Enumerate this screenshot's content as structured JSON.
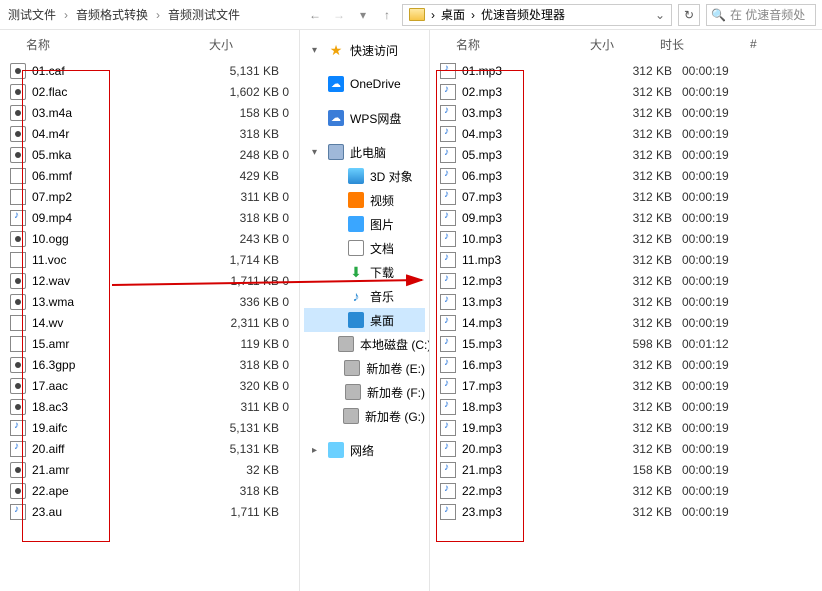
{
  "left_crumb": [
    "测试文件",
    "音频格式转换",
    "音频测试文件"
  ],
  "right_addr": {
    "parts": [
      "桌面",
      "优速音频处理器"
    ],
    "search_placeholder": "在 优速音频处"
  },
  "cols_left": {
    "name": "名称",
    "size": "大小"
  },
  "cols_right": {
    "name": "名称",
    "size": "大小",
    "duration": "时长",
    "num": "#"
  },
  "left_files": [
    {
      "ico": "audio",
      "name": "01.caf",
      "size": "5,131 KB"
    },
    {
      "ico": "audio",
      "name": "02.flac",
      "size": "1,602 KB",
      "extra": "0"
    },
    {
      "ico": "audio",
      "name": "03.m4a",
      "size": "158 KB",
      "extra": "0"
    },
    {
      "ico": "audio",
      "name": "04.m4r",
      "size": "318 KB"
    },
    {
      "ico": "audio",
      "name": "05.mka",
      "size": "248 KB",
      "extra": "0"
    },
    {
      "ico": "doc",
      "name": "06.mmf",
      "size": "429 KB"
    },
    {
      "ico": "doc",
      "name": "07.mp2",
      "size": "311 KB",
      "extra": "0"
    },
    {
      "ico": "mp3",
      "name": "09.mp4",
      "size": "318 KB",
      "extra": "0"
    },
    {
      "ico": "audio",
      "name": "10.ogg",
      "size": "243 KB",
      "extra": "0"
    },
    {
      "ico": "doc",
      "name": "11.voc",
      "size": "1,714 KB"
    },
    {
      "ico": "audio",
      "name": "12.wav",
      "size": "1,711 KB",
      "extra": "0"
    },
    {
      "ico": "audio",
      "name": "13.wma",
      "size": "336 KB",
      "extra": "0"
    },
    {
      "ico": "doc",
      "name": "14.wv",
      "size": "2,311 KB",
      "extra": "0"
    },
    {
      "ico": "doc",
      "name": "15.amr",
      "size": "119 KB",
      "extra": "0"
    },
    {
      "ico": "audio",
      "name": "16.3gpp",
      "size": "318 KB",
      "extra": "0"
    },
    {
      "ico": "audio",
      "name": "17.aac",
      "size": "320 KB",
      "extra": "0"
    },
    {
      "ico": "audio",
      "name": "18.ac3",
      "size": "311 KB",
      "extra": "0"
    },
    {
      "ico": "mp3",
      "name": "19.aifc",
      "size": "5,131 KB"
    },
    {
      "ico": "mp3",
      "name": "20.aiff",
      "size": "5,131 KB"
    },
    {
      "ico": "audio",
      "name": "21.amr",
      "size": "32 KB"
    },
    {
      "ico": "audio",
      "name": "22.ape",
      "size": "318 KB"
    },
    {
      "ico": "mp3",
      "name": "23.au",
      "size": "1,711 KB"
    }
  ],
  "right_files": [
    {
      "name": "01.mp3",
      "size": "312 KB",
      "dur": "00:00:19"
    },
    {
      "name": "02.mp3",
      "size": "312 KB",
      "dur": "00:00:19"
    },
    {
      "name": "03.mp3",
      "size": "312 KB",
      "dur": "00:00:19"
    },
    {
      "name": "04.mp3",
      "size": "312 KB",
      "dur": "00:00:19"
    },
    {
      "name": "05.mp3",
      "size": "312 KB",
      "dur": "00:00:19"
    },
    {
      "name": "06.mp3",
      "size": "312 KB",
      "dur": "00:00:19"
    },
    {
      "name": "07.mp3",
      "size": "312 KB",
      "dur": "00:00:19"
    },
    {
      "name": "09.mp3",
      "size": "312 KB",
      "dur": "00:00:19"
    },
    {
      "name": "10.mp3",
      "size": "312 KB",
      "dur": "00:00:19"
    },
    {
      "name": "11.mp3",
      "size": "312 KB",
      "dur": "00:00:19"
    },
    {
      "name": "12.mp3",
      "size": "312 KB",
      "dur": "00:00:19"
    },
    {
      "name": "13.mp3",
      "size": "312 KB",
      "dur": "00:00:19"
    },
    {
      "name": "14.mp3",
      "size": "312 KB",
      "dur": "00:00:19"
    },
    {
      "name": "15.mp3",
      "size": "598 KB",
      "dur": "00:01:12"
    },
    {
      "name": "16.mp3",
      "size": "312 KB",
      "dur": "00:00:19"
    },
    {
      "name": "17.mp3",
      "size": "312 KB",
      "dur": "00:00:19"
    },
    {
      "name": "18.mp3",
      "size": "312 KB",
      "dur": "00:00:19"
    },
    {
      "name": "19.mp3",
      "size": "312 KB",
      "dur": "00:00:19"
    },
    {
      "name": "20.mp3",
      "size": "312 KB",
      "dur": "00:00:19"
    },
    {
      "name": "21.mp3",
      "size": "158 KB",
      "dur": "00:00:19"
    },
    {
      "name": "22.mp3",
      "size": "312 KB",
      "dur": "00:00:19"
    },
    {
      "name": "23.mp3",
      "size": "312 KB",
      "dur": "00:00:19"
    }
  ],
  "tree": [
    {
      "chev": "▾",
      "ico": "star",
      "label": "快速访问"
    },
    {
      "chev": "",
      "ico": "cloud1",
      "label": "OneDrive"
    },
    {
      "chev": "",
      "ico": "cloud2",
      "label": "WPS网盘"
    },
    {
      "chev": "▾",
      "ico": "pc",
      "label": "此电脑"
    },
    {
      "chev": "",
      "ico": "3d",
      "label": "3D 对象",
      "indent": true
    },
    {
      "chev": "",
      "ico": "vid",
      "label": "视频",
      "indent": true
    },
    {
      "chev": "",
      "ico": "pic",
      "label": "图片",
      "indent": true
    },
    {
      "chev": "",
      "ico": "docs",
      "label": "文档",
      "indent": true
    },
    {
      "chev": "",
      "ico": "dl",
      "label": "下载",
      "indent": true
    },
    {
      "chev": "",
      "ico": "music",
      "label": "音乐",
      "indent": true
    },
    {
      "chev": "",
      "ico": "desk",
      "label": "桌面",
      "indent": true,
      "active": true
    },
    {
      "chev": "",
      "ico": "disk",
      "label": "本地磁盘 (C:)",
      "indent": true
    },
    {
      "chev": "",
      "ico": "disk",
      "label": "新加卷 (E:)",
      "indent": true
    },
    {
      "chev": "",
      "ico": "disk",
      "label": "新加卷 (F:)",
      "indent": true
    },
    {
      "chev": "",
      "ico": "disk",
      "label": "新加卷 (G:)",
      "indent": true
    },
    {
      "chev": "▸",
      "ico": "net",
      "label": "网络"
    }
  ]
}
